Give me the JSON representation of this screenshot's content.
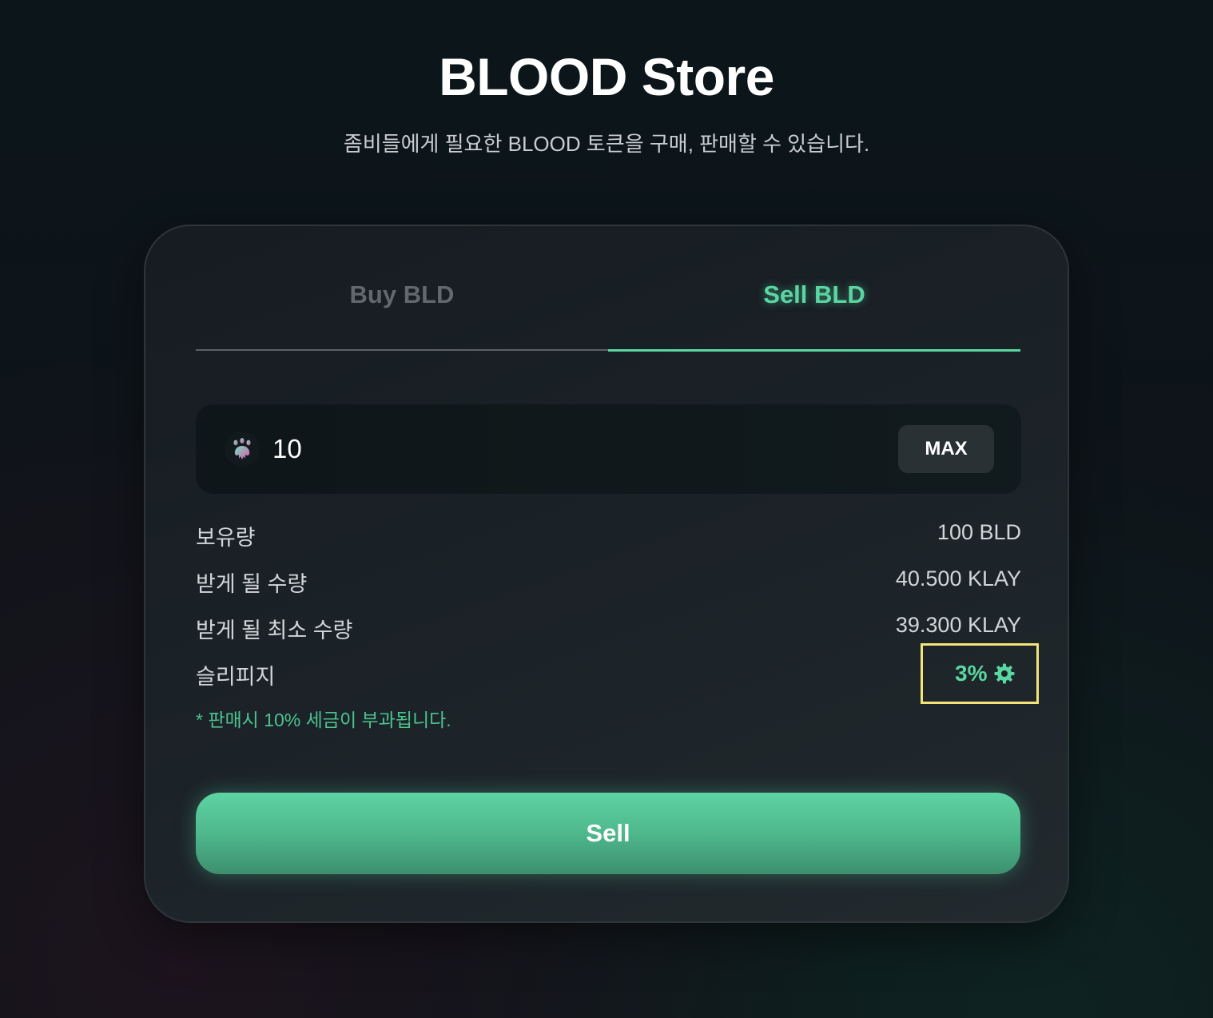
{
  "header": {
    "title": "BLOOD Store",
    "subtitle": "좀비들에게 필요한 BLOOD 토큰을 구매, 판매할 수 있습니다."
  },
  "tabs": [
    {
      "label": "Buy BLD",
      "active": false
    },
    {
      "label": "Sell BLD",
      "active": true
    }
  ],
  "amount_input": {
    "value": "10",
    "token_icon": "blood-token-icon"
  },
  "max_label": "MAX",
  "info": {
    "balance_label": "보유량",
    "balance_value": "100 BLD",
    "receive_label": "받게 될 수량",
    "receive_value": "40.500 KLAY",
    "min_receive_label": "받게 될 최소 수량",
    "min_receive_value": "39.300 KLAY",
    "slippage_label": "슬리피지",
    "slippage_value": "3%"
  },
  "tax_note": "* 판매시 10% 세금이 부과됩니다.",
  "sell_label": "Sell",
  "colors": {
    "accent": "#5ad6a2",
    "highlight_border": "#f4e37a",
    "background": "#0e1419"
  }
}
